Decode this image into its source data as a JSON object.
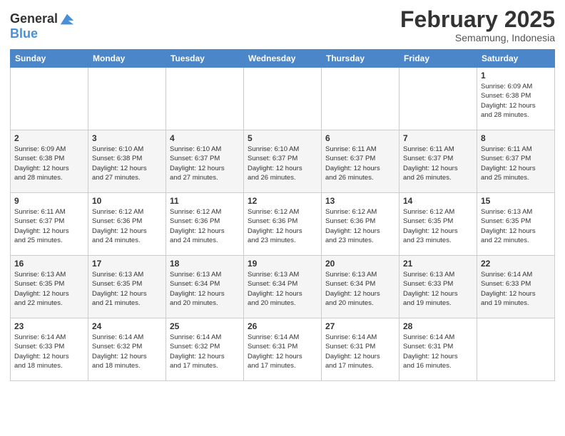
{
  "header": {
    "logo_line1": "General",
    "logo_line2": "Blue",
    "month_title": "February 2025",
    "location": "Semamung, Indonesia"
  },
  "weekdays": [
    "Sunday",
    "Monday",
    "Tuesday",
    "Wednesday",
    "Thursday",
    "Friday",
    "Saturday"
  ],
  "weeks": [
    [
      {
        "day": "",
        "info": ""
      },
      {
        "day": "",
        "info": ""
      },
      {
        "day": "",
        "info": ""
      },
      {
        "day": "",
        "info": ""
      },
      {
        "day": "",
        "info": ""
      },
      {
        "day": "",
        "info": ""
      },
      {
        "day": "1",
        "info": "Sunrise: 6:09 AM\nSunset: 6:38 PM\nDaylight: 12 hours\nand 28 minutes."
      }
    ],
    [
      {
        "day": "2",
        "info": "Sunrise: 6:09 AM\nSunset: 6:38 PM\nDaylight: 12 hours\nand 28 minutes."
      },
      {
        "day": "3",
        "info": "Sunrise: 6:10 AM\nSunset: 6:38 PM\nDaylight: 12 hours\nand 27 minutes."
      },
      {
        "day": "4",
        "info": "Sunrise: 6:10 AM\nSunset: 6:37 PM\nDaylight: 12 hours\nand 27 minutes."
      },
      {
        "day": "5",
        "info": "Sunrise: 6:10 AM\nSunset: 6:37 PM\nDaylight: 12 hours\nand 26 minutes."
      },
      {
        "day": "6",
        "info": "Sunrise: 6:11 AM\nSunset: 6:37 PM\nDaylight: 12 hours\nand 26 minutes."
      },
      {
        "day": "7",
        "info": "Sunrise: 6:11 AM\nSunset: 6:37 PM\nDaylight: 12 hours\nand 26 minutes."
      },
      {
        "day": "8",
        "info": "Sunrise: 6:11 AM\nSunset: 6:37 PM\nDaylight: 12 hours\nand 25 minutes."
      }
    ],
    [
      {
        "day": "9",
        "info": "Sunrise: 6:11 AM\nSunset: 6:37 PM\nDaylight: 12 hours\nand 25 minutes."
      },
      {
        "day": "10",
        "info": "Sunrise: 6:12 AM\nSunset: 6:36 PM\nDaylight: 12 hours\nand 24 minutes."
      },
      {
        "day": "11",
        "info": "Sunrise: 6:12 AM\nSunset: 6:36 PM\nDaylight: 12 hours\nand 24 minutes."
      },
      {
        "day": "12",
        "info": "Sunrise: 6:12 AM\nSunset: 6:36 PM\nDaylight: 12 hours\nand 23 minutes."
      },
      {
        "day": "13",
        "info": "Sunrise: 6:12 AM\nSunset: 6:36 PM\nDaylight: 12 hours\nand 23 minutes."
      },
      {
        "day": "14",
        "info": "Sunrise: 6:12 AM\nSunset: 6:35 PM\nDaylight: 12 hours\nand 23 minutes."
      },
      {
        "day": "15",
        "info": "Sunrise: 6:13 AM\nSunset: 6:35 PM\nDaylight: 12 hours\nand 22 minutes."
      }
    ],
    [
      {
        "day": "16",
        "info": "Sunrise: 6:13 AM\nSunset: 6:35 PM\nDaylight: 12 hours\nand 22 minutes."
      },
      {
        "day": "17",
        "info": "Sunrise: 6:13 AM\nSunset: 6:35 PM\nDaylight: 12 hours\nand 21 minutes."
      },
      {
        "day": "18",
        "info": "Sunrise: 6:13 AM\nSunset: 6:34 PM\nDaylight: 12 hours\nand 20 minutes."
      },
      {
        "day": "19",
        "info": "Sunrise: 6:13 AM\nSunset: 6:34 PM\nDaylight: 12 hours\nand 20 minutes."
      },
      {
        "day": "20",
        "info": "Sunrise: 6:13 AM\nSunset: 6:34 PM\nDaylight: 12 hours\nand 20 minutes."
      },
      {
        "day": "21",
        "info": "Sunrise: 6:13 AM\nSunset: 6:33 PM\nDaylight: 12 hours\nand 19 minutes."
      },
      {
        "day": "22",
        "info": "Sunrise: 6:14 AM\nSunset: 6:33 PM\nDaylight: 12 hours\nand 19 minutes."
      }
    ],
    [
      {
        "day": "23",
        "info": "Sunrise: 6:14 AM\nSunset: 6:33 PM\nDaylight: 12 hours\nand 18 minutes."
      },
      {
        "day": "24",
        "info": "Sunrise: 6:14 AM\nSunset: 6:32 PM\nDaylight: 12 hours\nand 18 minutes."
      },
      {
        "day": "25",
        "info": "Sunrise: 6:14 AM\nSunset: 6:32 PM\nDaylight: 12 hours\nand 17 minutes."
      },
      {
        "day": "26",
        "info": "Sunrise: 6:14 AM\nSunset: 6:31 PM\nDaylight: 12 hours\nand 17 minutes."
      },
      {
        "day": "27",
        "info": "Sunrise: 6:14 AM\nSunset: 6:31 PM\nDaylight: 12 hours\nand 17 minutes."
      },
      {
        "day": "28",
        "info": "Sunrise: 6:14 AM\nSunset: 6:31 PM\nDaylight: 12 hours\nand 16 minutes."
      },
      {
        "day": "",
        "info": ""
      }
    ]
  ]
}
